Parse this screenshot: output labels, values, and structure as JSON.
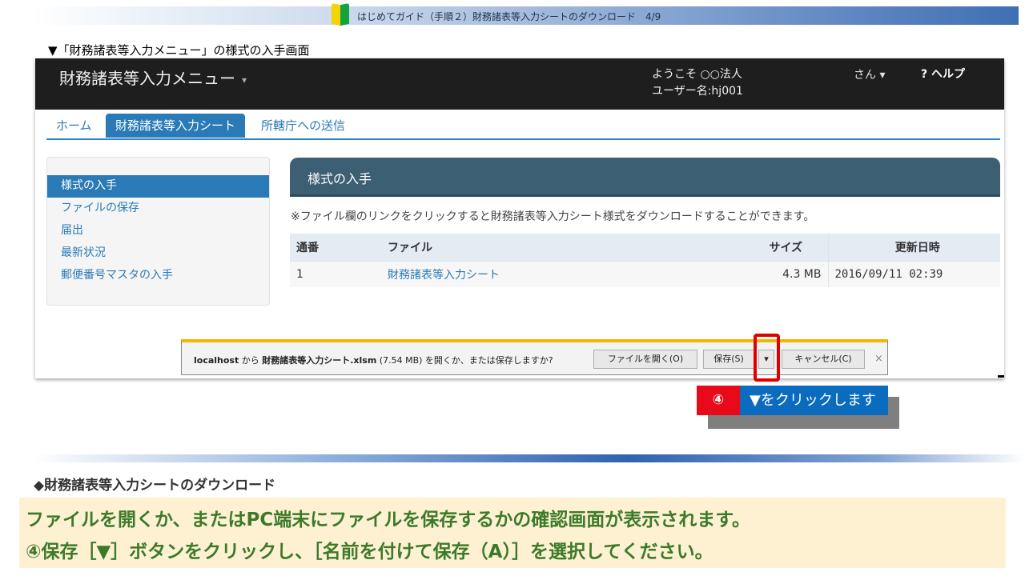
{
  "guide": {
    "title": "はじめてガイド（手順２）財務諸表等入力シートのダウンロード　4/9"
  },
  "caption": "▼「財務諸表等入力メニュー」の様式の入手画面",
  "app": {
    "brand": "財務諸表等入力メニュー",
    "brand_caret": "▾",
    "welcome_line1": "ようこそ ○○法人",
    "welcome_line2": "ユーザー名:hj001",
    "user_menu": "さん ▾",
    "help": "? ヘルプ"
  },
  "tabs": [
    {
      "label": "ホーム",
      "active": false
    },
    {
      "label": "財務諸表等入力シート",
      "active": true
    },
    {
      "label": "所轄庁への送信",
      "active": false
    }
  ],
  "sidebar": {
    "items": [
      {
        "label": "様式の入手",
        "active": true
      },
      {
        "label": "ファイルの保存",
        "active": false
      },
      {
        "label": "届出",
        "active": false
      },
      {
        "label": "最新状況",
        "active": false
      },
      {
        "label": "郵便番号マスタの入手",
        "active": false
      }
    ]
  },
  "main": {
    "header": "様式の入手",
    "notice": "※ファイル欄のリンクをクリックすると財務諸表等入力シート様式をダウンロードすることができます。",
    "table": {
      "columns": [
        "通番",
        "ファイル",
        "サイズ",
        "更新日時"
      ],
      "rows": [
        {
          "no": "1",
          "file": "財務諸表等入力シート",
          "size": "4.3 MB",
          "updated": "2016/09/11 02:39"
        }
      ]
    }
  },
  "download_bar": {
    "host": "localhost",
    "from": " から ",
    "filename": "財務諸表等入力シート.xlsm",
    "size": " (7.54 MB) ",
    "question": "を開くか、または保存しますか?",
    "open_label": "ファイルを開く(O)",
    "save_label": "保存(S)",
    "save_arrow": "▾",
    "cancel_label": "キャンセル(C)",
    "close_label": "×"
  },
  "callout": {
    "number": "④",
    "text": "▼をクリックします"
  },
  "section_title": "◆財務諸表等入力シートのダウンロード",
  "instructions": {
    "line1": "ファイルを開くか、またはPC端末にファイルを保存するかの確認画面が表示されます。",
    "line2": "④保存［▼］ボタンをクリックし、［名前を付けて保存（A）］を選択してください。"
  },
  "colors": {
    "nav_bg": "#1e1e1e",
    "accent_blue": "#2a7ab8",
    "header_slate": "#3d5f73",
    "highlight_red": "#e00000",
    "callout_blue": "#0b6bbf",
    "instruction_green": "#3c7a2a",
    "instruction_bg": "#fdf1d2"
  }
}
